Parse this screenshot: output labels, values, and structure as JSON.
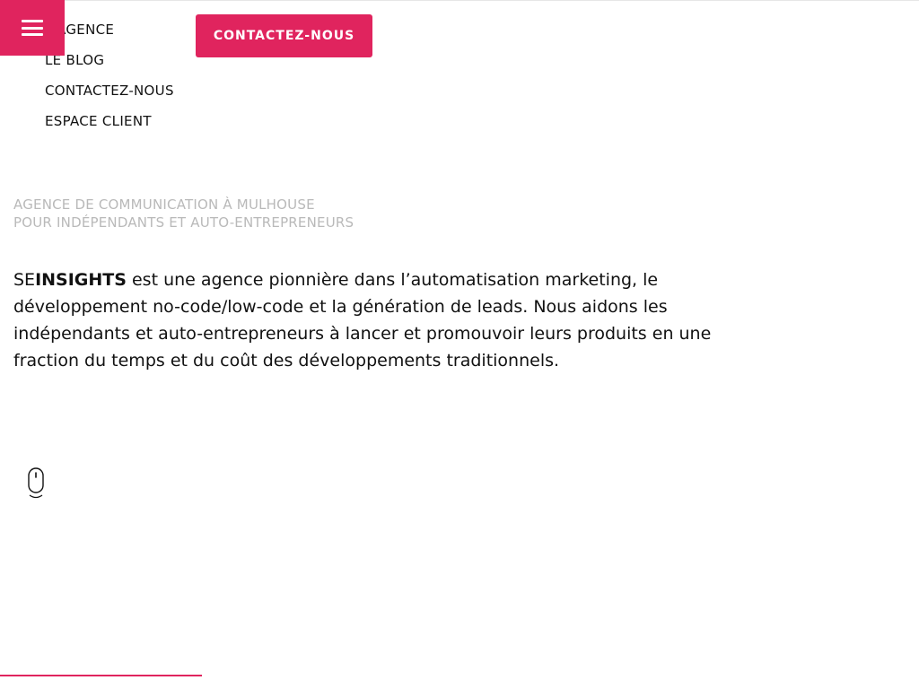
{
  "header": {
    "menu_icon": "hamburger-icon",
    "cta_label": "CONTACTEZ-NOUS"
  },
  "nav": {
    "items": [
      {
        "label": "L'AGENCE"
      },
      {
        "label": "LE BLOG"
      },
      {
        "label": "CONTACTEZ-NOUS"
      },
      {
        "label": "ESPACE CLIENT"
      }
    ]
  },
  "hero": {
    "eyebrow_line1": "AGENCE DE COMMUNICATION À MULHOUSE",
    "eyebrow_line2": "POUR INDÉPENDANTS ET AUTO-ENTREPRENEURS",
    "brand_prefix": "SE",
    "brand_bold": "INSIGHTS",
    "intro_text": " est une agence pionnière dans l’automatisation marketing, le développement no-code/low-code et la génération de leads. Nous aidons les indépendants et auto-entrepreneurs à lancer et promouvoir leurs produits en une fraction du temps et du coût des développements traditionnels.",
    "scroll_icon": "mouse-scroll-icon"
  },
  "colors": {
    "accent": "#e0245e",
    "text": "#111111",
    "muted": "#b9b9b9"
  }
}
